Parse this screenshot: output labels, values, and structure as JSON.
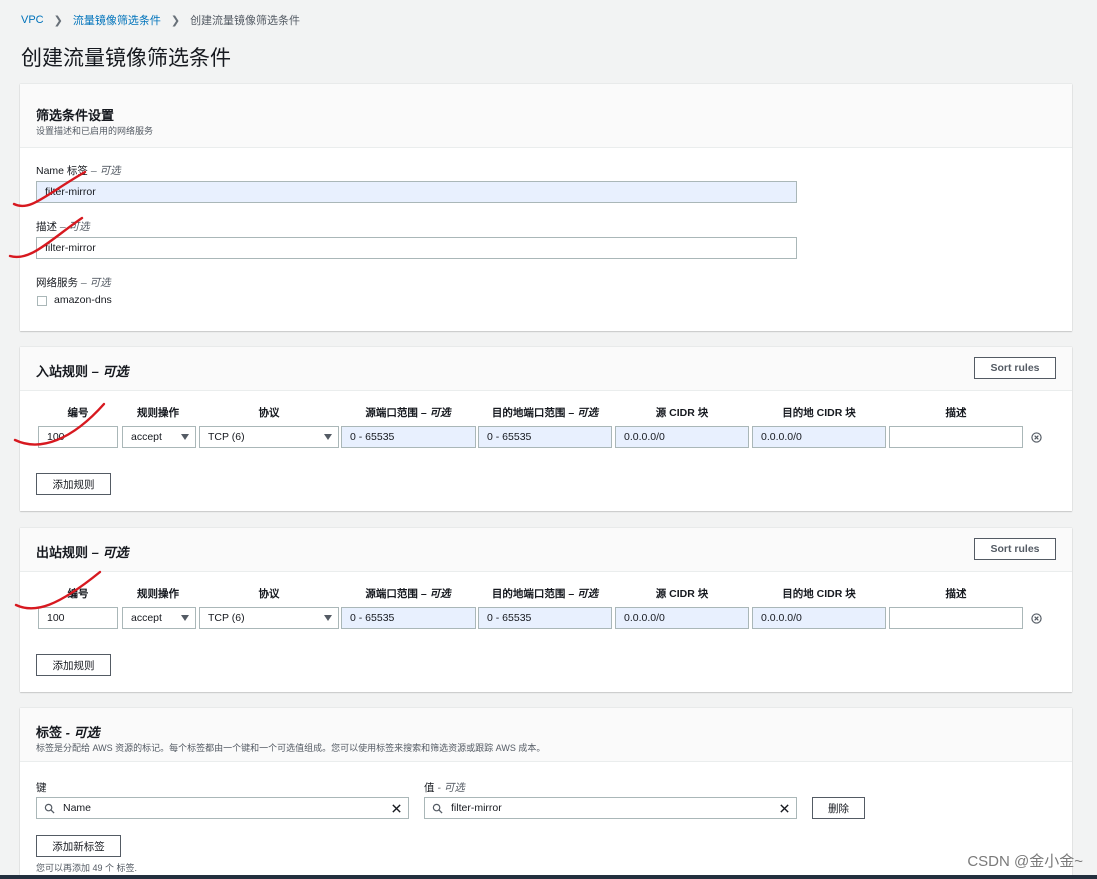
{
  "breadcrumb": {
    "vpc": "VPC",
    "filters": "流量镜像筛选条件",
    "current": "创建流量镜像筛选条件"
  },
  "page_title": "创建流量镜像筛选条件",
  "settings": {
    "title": "筛选条件设置",
    "desc": "设置描述和已启用的网络服务",
    "name_label": "Name 标签",
    "optional": "– 可选",
    "name_value": "filter-mirror",
    "desc_label": "描述",
    "desc_value": "filter-mirror",
    "services_label": "网络服务",
    "service_option": "amazon-dns"
  },
  "columns": {
    "number": "编号",
    "action": "规则操作",
    "protocol": "协议",
    "src_port": "源端口范围",
    "dst_port": "目的地端口范围",
    "optional": "– 可选",
    "src_cidr": "源 CIDR 块",
    "dst_cidr": "目的地 CIDR 块",
    "desc": "描述"
  },
  "inbound": {
    "title": "入站规则",
    "optional": " – 可选",
    "sort": "Sort rules",
    "add": "添加规则",
    "row": {
      "number": "100",
      "action": "accept",
      "protocol": "TCP (6)",
      "src_port": "0 - 65535",
      "dst_port": "0 - 65535",
      "src_cidr": "0.0.0.0/0",
      "dst_cidr": "0.0.0.0/0",
      "desc": ""
    }
  },
  "outbound": {
    "title": "出站规则",
    "optional": " – 可选",
    "sort": "Sort rules",
    "add": "添加规则",
    "row": {
      "number": "100",
      "action": "accept",
      "protocol": "TCP (6)",
      "src_port": "0 - 65535",
      "dst_port": "0 - 65535",
      "src_cidr": "0.0.0.0/0",
      "dst_cidr": "0.0.0.0/0",
      "desc": ""
    }
  },
  "tags": {
    "title": "标签",
    "optional": " - 可选",
    "desc": "标签是分配给 AWS 资源的标记。每个标签都由一个键和一个可选值组成。您可以使用标签来搜索和筛选资源或跟踪 AWS 成本。",
    "key_label": "键",
    "value_label": "值",
    "value_optional": " - 可选",
    "key_value": "Name",
    "value_value": "filter-mirror",
    "remove": "删除",
    "add": "添加新标签",
    "note": "您可以再添加 49 个 标签."
  },
  "watermark": "CSDN @金小金~"
}
